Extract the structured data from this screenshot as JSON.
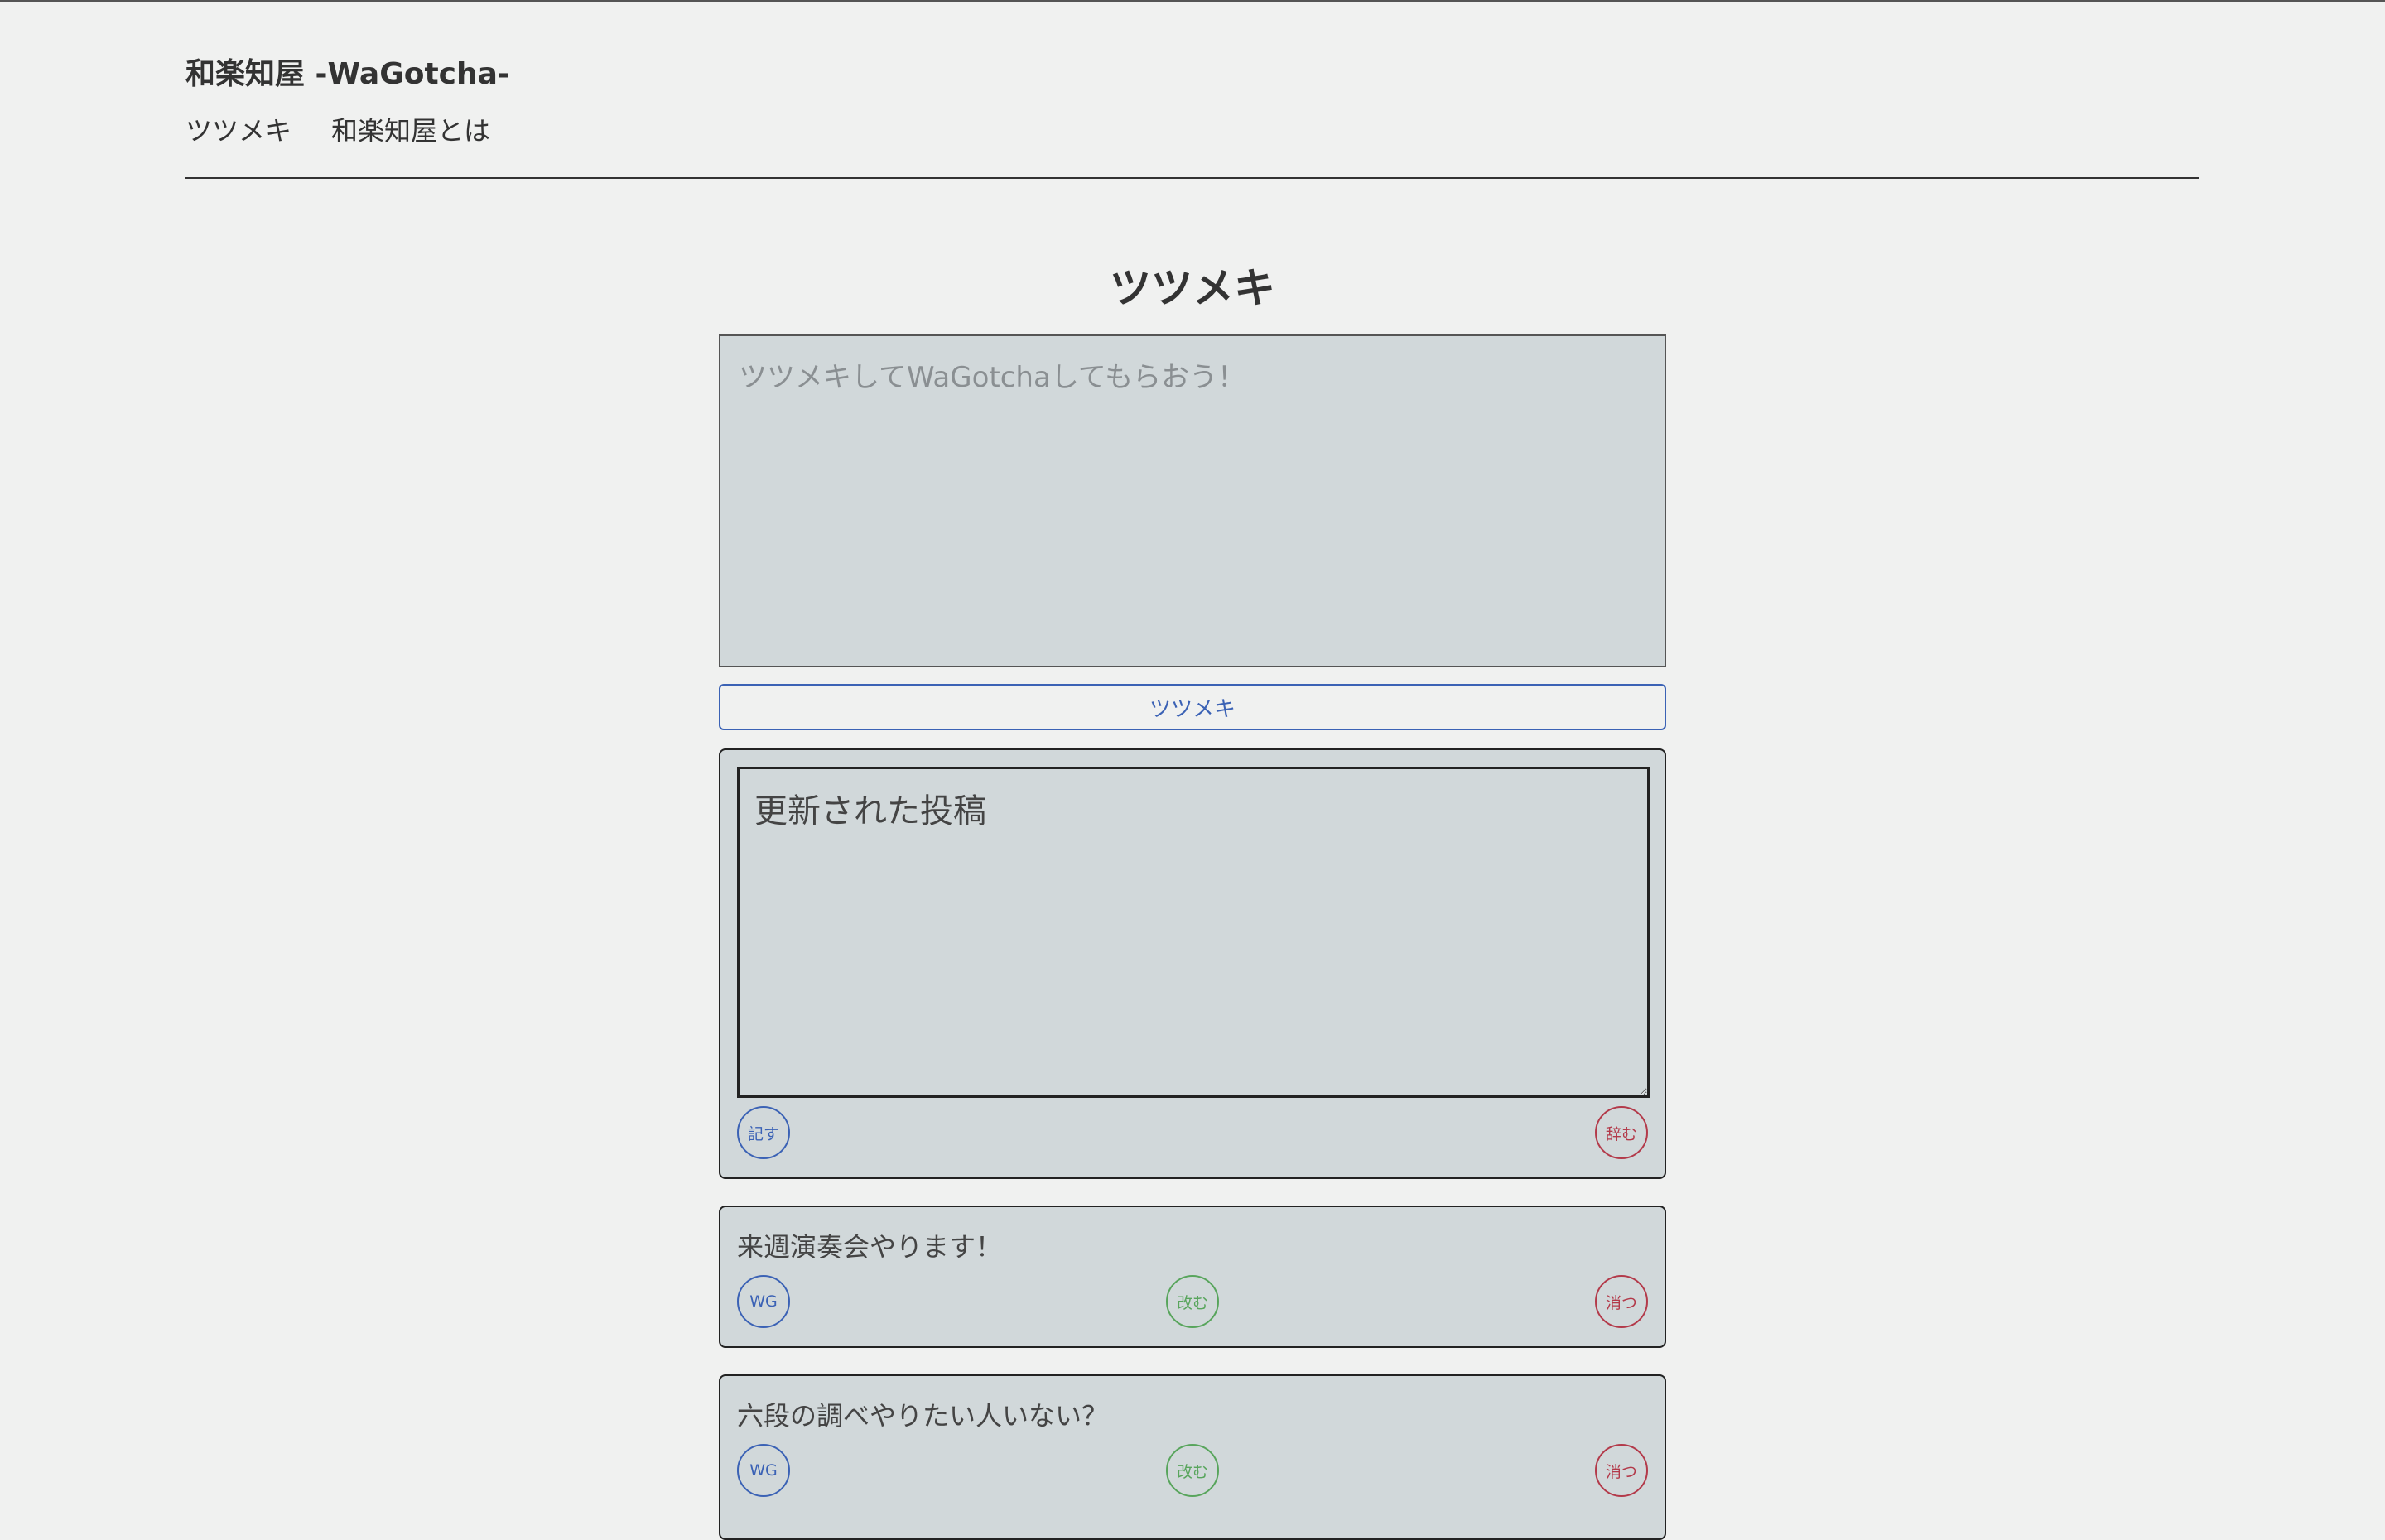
{
  "site": {
    "title": "和楽知屋 -WaGotcha-"
  },
  "nav": {
    "items": [
      {
        "label": "ツツメキ"
      },
      {
        "label": "和楽知屋とは"
      }
    ]
  },
  "main": {
    "title": "ツツメキ",
    "compose_placeholder": "ツツメキしてWaGotchaしてもらおう！",
    "submit_label": "ツツメキ"
  },
  "edit_card": {
    "value": "更新された投稿",
    "save_label": "記す",
    "cancel_label": "辞む"
  },
  "posts": [
    {
      "text": "来週演奏会やります！",
      "wg_label": "WG",
      "edit_label": "改む",
      "delete_label": "消つ"
    },
    {
      "text": "六段の調べやりたい人いない？",
      "wg_label": "WG",
      "edit_label": "改む",
      "delete_label": "消つ"
    }
  ],
  "colors": {
    "background": "#f0f1f0",
    "card": "#d1d8da",
    "primary_blue": "#3b62b5",
    "green": "#58a55c",
    "red": "#b33a4a"
  }
}
